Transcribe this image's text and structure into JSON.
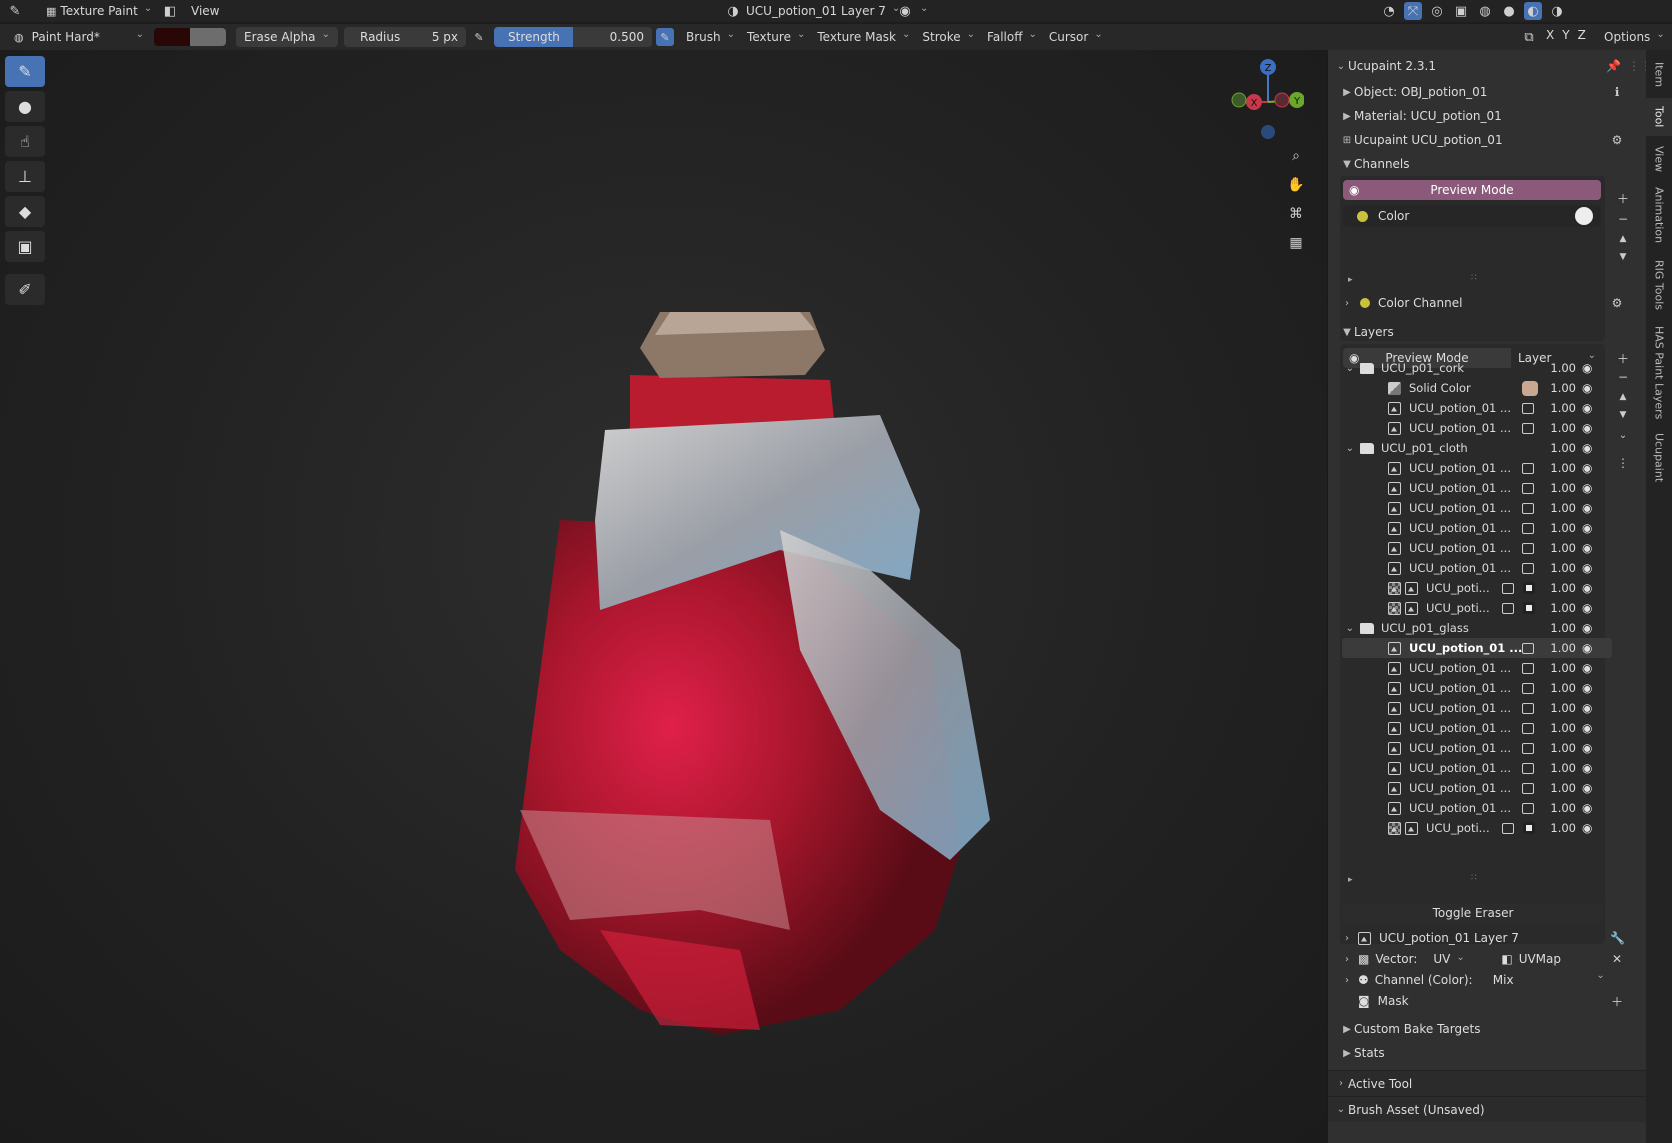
{
  "topbar": {
    "editor_mode": "Texture Paint",
    "view_menu": "View",
    "image_name": "UCU_potion_01 Layer 7"
  },
  "toolheader": {
    "brush_name": "Paint Hard*",
    "blend_mode": "Erase Alpha",
    "radius_label": "Radius",
    "radius_value": "5 px",
    "strength_label": "Strength",
    "strength_value": "0.500",
    "strength_fraction": 0.5,
    "menus": [
      "Brush",
      "Texture",
      "Texture Mask",
      "Stroke",
      "Falloff",
      "Cursor"
    ],
    "axes": [
      "X",
      "Y",
      "Z"
    ],
    "options": "Options"
  },
  "gizmo": {
    "z": "Z",
    "x": "X",
    "y": "Y"
  },
  "panel": {
    "title": "Ucupaint 2.3.1",
    "object": "Object: OBJ_potion_01",
    "material": "Material: UCU_potion_01",
    "ucupaint": "Ucupaint UCU_potion_01",
    "channels_header": "Channels",
    "preview_mode": "Preview Mode",
    "channel_color": "Color",
    "color_channel": "Color Channel",
    "layers_header": "Layers",
    "layers_preview": "Preview Mode",
    "layers_dropdown": "Layer",
    "layers": [
      {
        "name": "UCU_p01_cork",
        "value": "1.00",
        "kind": "folder",
        "depth": 0
      },
      {
        "name": "Solid Color",
        "value": "1.00",
        "kind": "solid",
        "depth": 1
      },
      {
        "name": "UCU_potion_01 ...",
        "value": "1.00",
        "kind": "image",
        "depth": 1
      },
      {
        "name": "UCU_potion_01 ...",
        "value": "1.00",
        "kind": "image",
        "depth": 1
      },
      {
        "name": "UCU_p01_cloth",
        "value": "1.00",
        "kind": "folder",
        "depth": 0
      },
      {
        "name": "UCU_potion_01 ...",
        "value": "1.00",
        "kind": "image",
        "depth": 1
      },
      {
        "name": "UCU_potion_01 ...",
        "value": "1.00",
        "kind": "image",
        "depth": 1
      },
      {
        "name": "UCU_potion_01 ...",
        "value": "1.00",
        "kind": "image",
        "depth": 1
      },
      {
        "name": "UCU_potion_01 ...",
        "value": "1.00",
        "kind": "image",
        "depth": 1
      },
      {
        "name": "UCU_potion_01 ...",
        "value": "1.00",
        "kind": "image",
        "depth": 1
      },
      {
        "name": "UCU_potion_01 ...",
        "value": "1.00",
        "kind": "image",
        "depth": 1
      },
      {
        "name": "UCU_poti...",
        "value": "1.00",
        "kind": "masked",
        "depth": 1
      },
      {
        "name": "UCU_poti...",
        "value": "1.00",
        "kind": "masked",
        "depth": 1
      },
      {
        "name": "UCU_p01_glass",
        "value": "1.00",
        "kind": "folder",
        "depth": 0
      },
      {
        "name": "UCU_potion_01 ...",
        "value": "1.00",
        "kind": "image",
        "depth": 1,
        "selected": true
      },
      {
        "name": "UCU_potion_01 ...",
        "value": "1.00",
        "kind": "image",
        "depth": 1
      },
      {
        "name": "UCU_potion_01 ...",
        "value": "1.00",
        "kind": "image",
        "depth": 1
      },
      {
        "name": "UCU_potion_01 ...",
        "value": "1.00",
        "kind": "image",
        "depth": 1
      },
      {
        "name": "UCU_potion_01 ...",
        "value": "1.00",
        "kind": "image",
        "depth": 1
      },
      {
        "name": "UCU_potion_01 ...",
        "value": "1.00",
        "kind": "image",
        "depth": 1
      },
      {
        "name": "UCU_potion_01 ...",
        "value": "1.00",
        "kind": "image",
        "depth": 1
      },
      {
        "name": "UCU_potion_01 ...",
        "value": "1.00",
        "kind": "image",
        "depth": 1
      },
      {
        "name": "UCU_potion_01 ...",
        "value": "1.00",
        "kind": "image",
        "depth": 1
      },
      {
        "name": "UCU_poti...",
        "value": "1.00",
        "kind": "masked",
        "depth": 1
      }
    ],
    "toggle_eraser": "Toggle Eraser",
    "active_layer": "UCU_potion_01 Layer 7",
    "vector_label": "Vector:",
    "vector_value": "UV",
    "uvmap": "UVMap",
    "channel_color_label": "Channel (Color):",
    "channel_color_value": "Mix",
    "mask": "Mask",
    "custom_bake": "Custom Bake Targets",
    "stats": "Stats",
    "active_tool": "Active Tool",
    "brush_asset": "Brush Asset (Unsaved)"
  },
  "vtabs": [
    "Item",
    "Tool",
    "View",
    "Animation",
    "RIG Tools",
    "HAS Paint Layers",
    "Ucupaint"
  ],
  "colors": {
    "accent": "#4772b3",
    "preview": "#8b5a7a",
    "channel_dot": "#c9c23a",
    "solid_swatch": "#c9a891",
    "potion_red": "#b01a2e"
  }
}
